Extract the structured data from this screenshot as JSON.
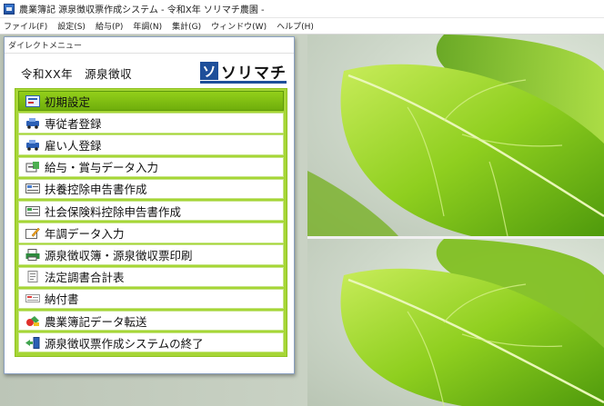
{
  "window_title": "農業簿記 源泉徴収票作成システム - 令和X年 ソリマチ農園 -",
  "menu": [
    "ファイル(F)",
    "設定(S)",
    "給与(P)",
    "年調(N)",
    "集計(G)",
    "ウィンドウ(W)",
    "ヘルプ(H)"
  ],
  "direct_menu": {
    "title": "ダイレクトメニュー",
    "heading": "令和XX年　源泉徴収",
    "logo_mark": "ソ",
    "logo_text": "ソリマチ",
    "items": [
      {
        "label": "初期設定",
        "icon": "settings-icon",
        "active": true
      },
      {
        "label": "専従者登録",
        "icon": "car-icon"
      },
      {
        "label": "雇い人登録",
        "icon": "car-icon"
      },
      {
        "label": "給与・賞与データ入力",
        "icon": "money-icon"
      },
      {
        "label": "扶養控除申告書作成",
        "icon": "form-icon"
      },
      {
        "label": "社会保険料控除申告書作成",
        "icon": "form-icon"
      },
      {
        "label": "年調データ入力",
        "icon": "edit-icon"
      },
      {
        "label": "源泉徴収簿・源泉徴収票印刷",
        "icon": "print-icon"
      },
      {
        "label": "法定調書合計表",
        "icon": "document-icon"
      },
      {
        "label": "納付書",
        "icon": "receipt-icon"
      },
      {
        "label": "農業簿記データ転送",
        "icon": "transfer-icon"
      },
      {
        "label": "源泉徴収票作成システムの終了",
        "icon": "exit-icon"
      }
    ]
  },
  "colors": {
    "panel_green": "#a6d636",
    "active_green": "#7fbf14",
    "logo_blue": "#1e4f9a"
  }
}
